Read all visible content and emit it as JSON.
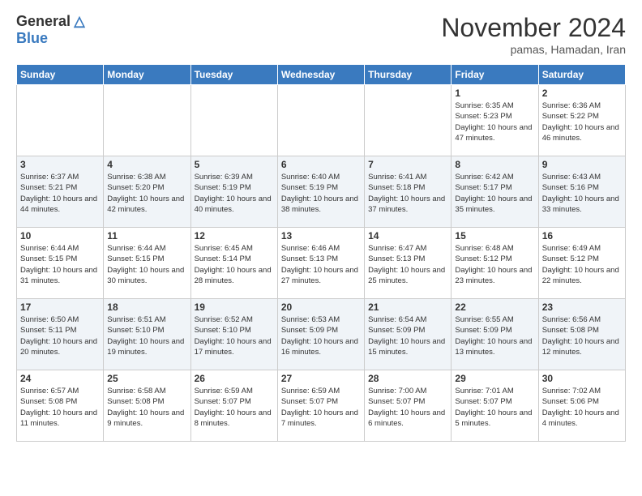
{
  "header": {
    "logo_general": "General",
    "logo_blue": "Blue",
    "month": "November 2024",
    "location": "pamas, Hamadan, Iran"
  },
  "days_of_week": [
    "Sunday",
    "Monday",
    "Tuesday",
    "Wednesday",
    "Thursday",
    "Friday",
    "Saturday"
  ],
  "weeks": [
    [
      {
        "day": "",
        "info": ""
      },
      {
        "day": "",
        "info": ""
      },
      {
        "day": "",
        "info": ""
      },
      {
        "day": "",
        "info": ""
      },
      {
        "day": "",
        "info": ""
      },
      {
        "day": "1",
        "info": "Sunrise: 6:35 AM\nSunset: 5:23 PM\nDaylight: 10 hours and 47 minutes."
      },
      {
        "day": "2",
        "info": "Sunrise: 6:36 AM\nSunset: 5:22 PM\nDaylight: 10 hours and 46 minutes."
      }
    ],
    [
      {
        "day": "3",
        "info": "Sunrise: 6:37 AM\nSunset: 5:21 PM\nDaylight: 10 hours and 44 minutes."
      },
      {
        "day": "4",
        "info": "Sunrise: 6:38 AM\nSunset: 5:20 PM\nDaylight: 10 hours and 42 minutes."
      },
      {
        "day": "5",
        "info": "Sunrise: 6:39 AM\nSunset: 5:19 PM\nDaylight: 10 hours and 40 minutes."
      },
      {
        "day": "6",
        "info": "Sunrise: 6:40 AM\nSunset: 5:19 PM\nDaylight: 10 hours and 38 minutes."
      },
      {
        "day": "7",
        "info": "Sunrise: 6:41 AM\nSunset: 5:18 PM\nDaylight: 10 hours and 37 minutes."
      },
      {
        "day": "8",
        "info": "Sunrise: 6:42 AM\nSunset: 5:17 PM\nDaylight: 10 hours and 35 minutes."
      },
      {
        "day": "9",
        "info": "Sunrise: 6:43 AM\nSunset: 5:16 PM\nDaylight: 10 hours and 33 minutes."
      }
    ],
    [
      {
        "day": "10",
        "info": "Sunrise: 6:44 AM\nSunset: 5:15 PM\nDaylight: 10 hours and 31 minutes."
      },
      {
        "day": "11",
        "info": "Sunrise: 6:44 AM\nSunset: 5:15 PM\nDaylight: 10 hours and 30 minutes."
      },
      {
        "day": "12",
        "info": "Sunrise: 6:45 AM\nSunset: 5:14 PM\nDaylight: 10 hours and 28 minutes."
      },
      {
        "day": "13",
        "info": "Sunrise: 6:46 AM\nSunset: 5:13 PM\nDaylight: 10 hours and 27 minutes."
      },
      {
        "day": "14",
        "info": "Sunrise: 6:47 AM\nSunset: 5:13 PM\nDaylight: 10 hours and 25 minutes."
      },
      {
        "day": "15",
        "info": "Sunrise: 6:48 AM\nSunset: 5:12 PM\nDaylight: 10 hours and 23 minutes."
      },
      {
        "day": "16",
        "info": "Sunrise: 6:49 AM\nSunset: 5:12 PM\nDaylight: 10 hours and 22 minutes."
      }
    ],
    [
      {
        "day": "17",
        "info": "Sunrise: 6:50 AM\nSunset: 5:11 PM\nDaylight: 10 hours and 20 minutes."
      },
      {
        "day": "18",
        "info": "Sunrise: 6:51 AM\nSunset: 5:10 PM\nDaylight: 10 hours and 19 minutes."
      },
      {
        "day": "19",
        "info": "Sunrise: 6:52 AM\nSunset: 5:10 PM\nDaylight: 10 hours and 17 minutes."
      },
      {
        "day": "20",
        "info": "Sunrise: 6:53 AM\nSunset: 5:09 PM\nDaylight: 10 hours and 16 minutes."
      },
      {
        "day": "21",
        "info": "Sunrise: 6:54 AM\nSunset: 5:09 PM\nDaylight: 10 hours and 15 minutes."
      },
      {
        "day": "22",
        "info": "Sunrise: 6:55 AM\nSunset: 5:09 PM\nDaylight: 10 hours and 13 minutes."
      },
      {
        "day": "23",
        "info": "Sunrise: 6:56 AM\nSunset: 5:08 PM\nDaylight: 10 hours and 12 minutes."
      }
    ],
    [
      {
        "day": "24",
        "info": "Sunrise: 6:57 AM\nSunset: 5:08 PM\nDaylight: 10 hours and 11 minutes."
      },
      {
        "day": "25",
        "info": "Sunrise: 6:58 AM\nSunset: 5:08 PM\nDaylight: 10 hours and 9 minutes."
      },
      {
        "day": "26",
        "info": "Sunrise: 6:59 AM\nSunset: 5:07 PM\nDaylight: 10 hours and 8 minutes."
      },
      {
        "day": "27",
        "info": "Sunrise: 6:59 AM\nSunset: 5:07 PM\nDaylight: 10 hours and 7 minutes."
      },
      {
        "day": "28",
        "info": "Sunrise: 7:00 AM\nSunset: 5:07 PM\nDaylight: 10 hours and 6 minutes."
      },
      {
        "day": "29",
        "info": "Sunrise: 7:01 AM\nSunset: 5:07 PM\nDaylight: 10 hours and 5 minutes."
      },
      {
        "day": "30",
        "info": "Sunrise: 7:02 AM\nSunset: 5:06 PM\nDaylight: 10 hours and 4 minutes."
      }
    ]
  ]
}
